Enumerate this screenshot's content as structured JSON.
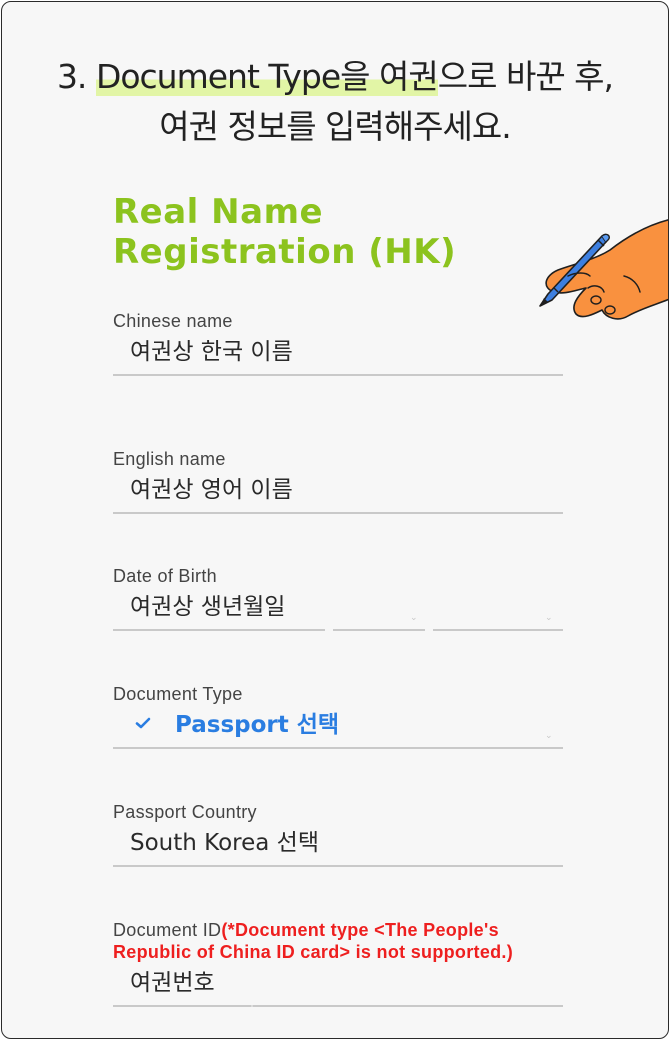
{
  "headline": {
    "step": "3.",
    "highlight": "Document Type을 여권",
    "line1_rest": "으로 바꾼 후,",
    "line2": "여권 정보를 입력해주세요."
  },
  "form": {
    "title": "Real Name Registration (HK)",
    "fields": {
      "chinese_name": {
        "label": "Chinese name",
        "value": "여권상 한국 이름"
      },
      "english_name": {
        "label": "English name",
        "value": "여권상 영어 이름"
      },
      "date_of_birth": {
        "label": "Date of Birth",
        "value": "여권상 생년월일"
      },
      "document_type": {
        "label": "Document Type",
        "value": "Passport 선택"
      },
      "passport_country": {
        "label": "Passport Country",
        "value": "South Korea 선택"
      },
      "document_id": {
        "label": "Document ID",
        "note": "(*Document type <The People's Republic of China ID card> is not supported.)",
        "value": "여권번호"
      }
    }
  },
  "colors": {
    "title_green": "#8cc31e",
    "highlight": "#e2f5a6",
    "selected_blue": "#2a7de1",
    "note_red": "#ee1f1f",
    "hand_orange": "#f9913f",
    "pen_blue": "#3d7fe0"
  },
  "icons": {
    "check": "check-icon",
    "caret": "chevron-down-icon",
    "illustration": "hand-writing-with-pen"
  }
}
